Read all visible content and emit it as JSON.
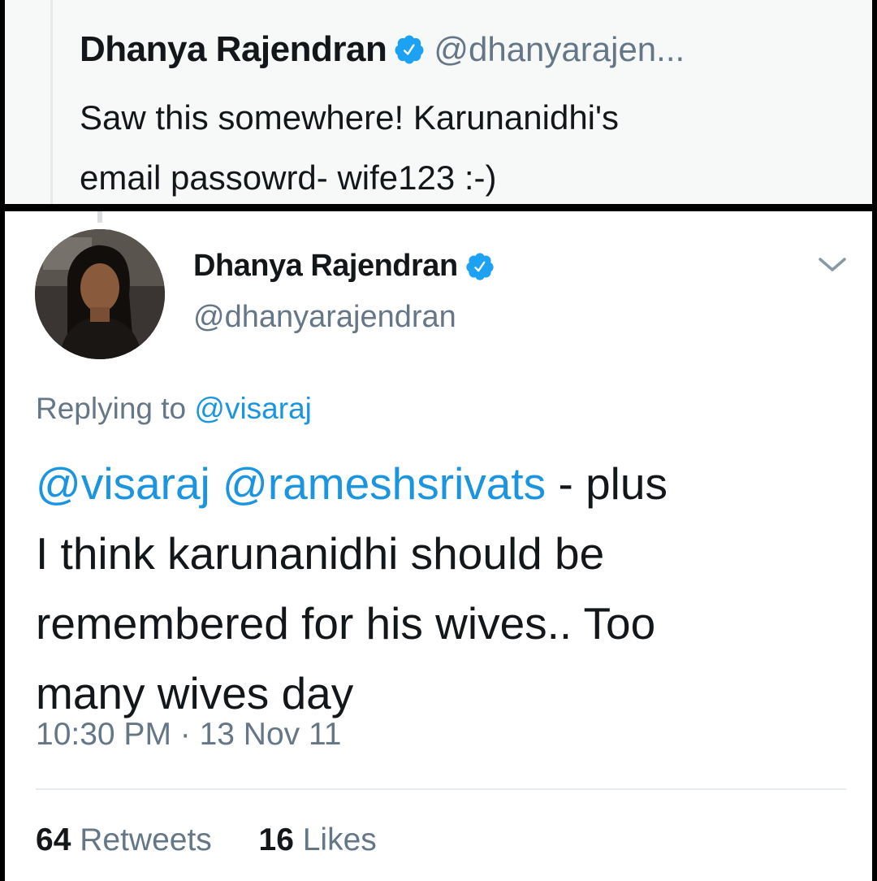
{
  "quoted_tweet": {
    "name": "Dhanya Rajendran",
    "handle": "@dhanyarajen...",
    "text_line1": "Saw this somewhere! Karunanidhi's",
    "text_line2": "email passowrd- wife123 :-)"
  },
  "tweet": {
    "name": "Dhanya Rajendran",
    "handle": "@dhanyarajendran",
    "replying_prefix": "Replying to",
    "replying_to": "@visaraj",
    "mention1": "@visaraj",
    "mention2": "@rameshsrivats",
    "text_after_mentions": "- plus",
    "text_line2": "I think karunanidhi should be",
    "text_line3": "remembered for his wives.. Too",
    "text_line4": "many wives day",
    "timestamp": "10:30 PM · 13 Nov 11",
    "retweets_count": "64",
    "retweets_label": "Retweets",
    "likes_count": "16",
    "likes_label": "Likes"
  },
  "icons": {
    "verified": "verified-badge-icon",
    "caret": "chevron-down-icon"
  },
  "colors": {
    "link": "#1b95e0",
    "verified": "#1da1f2",
    "muted": "#657786",
    "text": "#14171a"
  }
}
